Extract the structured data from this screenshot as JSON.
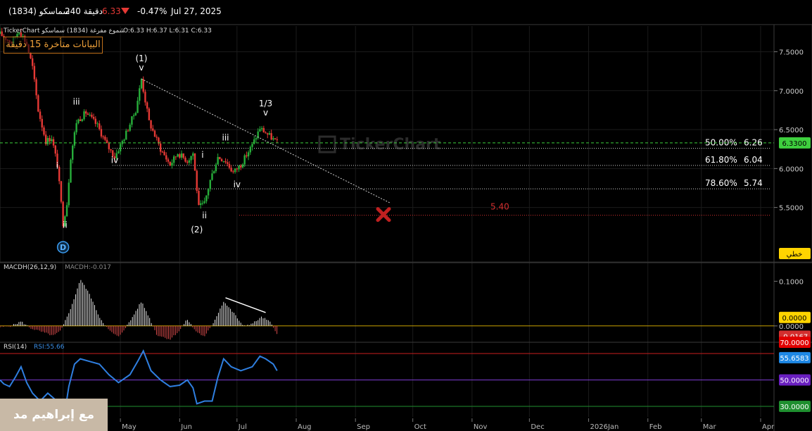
{
  "topbar": {
    "symbol": "سماسكو (1834)",
    "volume": "240 دقيقة",
    "price": "6.33",
    "change": "-0.47%",
    "date": "Jul 27, 2025"
  },
  "header": {
    "title": "TickerChart  شموع مفرغة (1834) سماسكو",
    "ohlc": "O:6.33  H:6.37  L:6.31  C:6.33"
  },
  "delay_notice": "البيانات متأخرة 15 دقيقة",
  "watermark_logo": "TickerChart",
  "watermark_author": "مع إبراهيم مد",
  "badges": {
    "last_price": "6.3300",
    "scale_mode": "خطي",
    "macd_zero": "0.0000",
    "macd_last": "-0.0167",
    "rsi_70": "70.0000",
    "rsi_last": "55.6583",
    "rsi_50": "50.0000",
    "rsi_30": "30.0000"
  },
  "fib_levels": [
    {
      "pct": "50.00%",
      "value": "6.26",
      "level": 6.26
    },
    {
      "pct": "61.80%",
      "value": "6.04",
      "level": 6.04
    },
    {
      "pct": "78.60%",
      "value": "5.74",
      "level": 5.74
    }
  ],
  "target": {
    "label": "5.40",
    "level": 5.4
  },
  "wave_labels": [
    {
      "text": "(1)",
      "x": "2025-05-12",
      "y": 7.38
    },
    {
      "text": "v",
      "x": "2025-05-12",
      "y": 7.26
    },
    {
      "text": "iii",
      "x": "2025-04-08",
      "y": 6.82
    },
    {
      "text": "iv",
      "x": "2025-04-28",
      "y": 6.07
    },
    {
      "text": "i",
      "x": "2025-03-29",
      "y": 6.0
    },
    {
      "text": "ii",
      "x": "2025-04-02",
      "y": 5.24
    },
    {
      "text": "(2)",
      "x": "2025-06-10",
      "y": 5.18
    },
    {
      "text": "ii",
      "x": "2025-06-14",
      "y": 5.36
    },
    {
      "text": "i",
      "x": "2025-06-13",
      "y": 6.14
    },
    {
      "text": "iii",
      "x": "2025-06-25",
      "y": 6.36
    },
    {
      "text": "iv",
      "x": "2025-07-01",
      "y": 5.76
    },
    {
      "text": "1/3",
      "x": "2025-07-16",
      "y": 6.8
    },
    {
      "text": "v",
      "x": "2025-07-16",
      "y": 6.68
    },
    {
      "text": "D",
      "x": "2025-04-01",
      "y": 4.99
    }
  ],
  "chart_data": [
    {
      "type": "candlestick",
      "name": "price",
      "x_ticks": [
        "Apr",
        "May",
        "Jun",
        "Jul",
        "Aug",
        "Sep",
        "Oct",
        "Nov",
        "Dec",
        "2026Jan",
        "Feb",
        "Mar",
        "Apr"
      ],
      "x_tick_dates": [
        "2025-04-01",
        "2025-05-01",
        "2025-06-01",
        "2025-07-01",
        "2025-08-01",
        "2025-09-01",
        "2025-10-01",
        "2025-11-01",
        "2025-12-01",
        "2026-01-01",
        "2026-02-01",
        "2026-03-01",
        "2026-04-01"
      ],
      "x_range": [
        "2025-02-27",
        "2026-04-08"
      ],
      "y_ticks": [
        "7.5000",
        "7.0000",
        "6.5000",
        "6.0000",
        "5.5000"
      ],
      "y_range": [
        4.8,
        7.83
      ],
      "last_price": 6.33,
      "ohlc_last": {
        "open": 6.33,
        "high": 6.37,
        "low": 6.31,
        "close": 6.33
      },
      "path": [
        [
          "2025-02-27",
          7.73
        ],
        [
          "2025-03-05",
          7.62
        ],
        [
          "2025-03-09",
          7.78
        ],
        [
          "2025-03-13",
          7.6
        ],
        [
          "2025-03-16",
          7.3
        ],
        [
          "2025-03-19",
          6.75
        ],
        [
          "2025-03-23",
          6.35
        ],
        [
          "2025-03-26",
          6.4
        ],
        [
          "2025-03-29",
          6.05
        ],
        [
          "2025-04-01",
          5.3
        ],
        [
          "2025-04-03",
          5.55
        ],
        [
          "2025-04-05",
          6.15
        ],
        [
          "2025-04-08",
          6.6
        ],
        [
          "2025-04-13",
          6.72
        ],
        [
          "2025-04-19",
          6.55
        ],
        [
          "2025-04-24",
          6.3
        ],
        [
          "2025-04-28",
          6.15
        ],
        [
          "2025-05-03",
          6.4
        ],
        [
          "2025-05-09",
          6.75
        ],
        [
          "2025-05-12",
          7.15
        ],
        [
          "2025-05-16",
          6.6
        ],
        [
          "2025-05-22",
          6.25
        ],
        [
          "2025-05-27",
          6.05
        ],
        [
          "2025-05-31",
          6.2
        ],
        [
          "2025-06-05",
          6.1
        ],
        [
          "2025-06-08",
          6.2
        ],
        [
          "2025-06-11",
          5.5
        ],
        [
          "2025-06-14",
          5.55
        ],
        [
          "2025-06-17",
          5.85
        ],
        [
          "2025-06-21",
          6.15
        ],
        [
          "2025-06-25",
          6.1
        ],
        [
          "2025-06-29",
          5.95
        ],
        [
          "2025-07-03",
          6.05
        ],
        [
          "2025-07-09",
          6.3
        ],
        [
          "2025-07-13",
          6.52
        ],
        [
          "2025-07-18",
          6.42
        ],
        [
          "2025-07-22",
          6.33
        ]
      ],
      "trendline": [
        [
          "2025-05-12",
          7.15
        ],
        [
          "2025-09-19",
          5.56
        ]
      ]
    },
    {
      "type": "bar",
      "name": "MACDH(26,12,9)",
      "legend": "MACDH(26,12,9)",
      "value_label": "MACDH:-0.017",
      "y_ticks": [
        "0.1000",
        "0.0000"
      ],
      "y_range": [
        -0.035,
        0.14
      ],
      "last_value": -0.0167,
      "path": [
        [
          "2025-02-27",
          -0.003
        ],
        [
          "2025-03-05",
          0.0
        ],
        [
          "2025-03-10",
          0.01
        ],
        [
          "2025-03-15",
          -0.005
        ],
        [
          "2025-03-22",
          -0.015
        ],
        [
          "2025-03-27",
          -0.022
        ],
        [
          "2025-03-31",
          -0.01
        ],
        [
          "2025-04-03",
          0.02
        ],
        [
          "2025-04-06",
          0.05
        ],
        [
          "2025-04-10",
          0.105
        ],
        [
          "2025-04-15",
          0.07
        ],
        [
          "2025-04-20",
          0.02
        ],
        [
          "2025-04-25",
          -0.01
        ],
        [
          "2025-04-30",
          -0.025
        ],
        [
          "2025-05-06",
          0.01
        ],
        [
          "2025-05-12",
          0.055
        ],
        [
          "2025-05-16",
          0.02
        ],
        [
          "2025-05-20",
          -0.02
        ],
        [
          "2025-05-27",
          -0.03
        ],
        [
          "2025-06-01",
          -0.01
        ],
        [
          "2025-06-05",
          0.015
        ],
        [
          "2025-06-09",
          -0.01
        ],
        [
          "2025-06-14",
          -0.025
        ],
        [
          "2025-06-19",
          0.01
        ],
        [
          "2025-06-24",
          0.055
        ],
        [
          "2025-06-30",
          0.025
        ],
        [
          "2025-07-04",
          0.0
        ],
        [
          "2025-07-09",
          0.005
        ],
        [
          "2025-07-14",
          0.02
        ],
        [
          "2025-07-18",
          0.01
        ],
        [
          "2025-07-22",
          -0.0167
        ]
      ],
      "divergence_line": [
        [
          "2025-06-25",
          0.063
        ],
        [
          "2025-07-16",
          0.03
        ]
      ]
    },
    {
      "type": "line",
      "name": "RSI(14)",
      "legend": "RSI(14)",
      "value_label": "RSI:55.66",
      "y_range": [
        22,
        78
      ],
      "levels": [
        70,
        50,
        30
      ],
      "last_value": 55.6583,
      "values": [
        [
          "2025-02-27",
          50
        ],
        [
          "2025-03-01",
          47
        ],
        [
          "2025-03-04",
          45
        ],
        [
          "2025-03-07",
          52
        ],
        [
          "2025-03-10",
          60
        ],
        [
          "2025-03-13",
          48
        ],
        [
          "2025-03-16",
          40
        ],
        [
          "2025-03-20",
          34
        ],
        [
          "2025-03-24",
          40
        ],
        [
          "2025-03-28",
          35
        ],
        [
          "2025-03-31",
          28
        ],
        [
          "2025-04-02",
          26
        ],
        [
          "2025-04-04",
          45
        ],
        [
          "2025-04-07",
          62
        ],
        [
          "2025-04-10",
          66
        ],
        [
          "2025-04-15",
          64
        ],
        [
          "2025-04-20",
          62
        ],
        [
          "2025-04-25",
          54
        ],
        [
          "2025-04-30",
          48
        ],
        [
          "2025-05-06",
          54
        ],
        [
          "2025-05-10",
          64
        ],
        [
          "2025-05-13",
          72
        ],
        [
          "2025-05-17",
          57
        ],
        [
          "2025-05-22",
          50
        ],
        [
          "2025-05-27",
          45
        ],
        [
          "2025-06-01",
          46
        ],
        [
          "2025-06-05",
          50
        ],
        [
          "2025-06-08",
          44
        ],
        [
          "2025-06-10",
          32
        ],
        [
          "2025-06-14",
          34
        ],
        [
          "2025-06-18",
          34
        ],
        [
          "2025-06-21",
          52
        ],
        [
          "2025-06-24",
          66
        ],
        [
          "2025-06-28",
          60
        ],
        [
          "2025-07-03",
          57
        ],
        [
          "2025-07-09",
          60
        ],
        [
          "2025-07-13",
          68
        ],
        [
          "2025-07-16",
          66
        ],
        [
          "2025-07-20",
          62
        ],
        [
          "2025-07-22",
          57
        ]
      ]
    }
  ],
  "colors": {
    "up": "#27ae3a",
    "down": "#e53935",
    "grid": "#1b1b1b",
    "macd_pos": "#e6e6e6",
    "macd_neg": "#d94b4b",
    "rsi_line": "#2f7fe0",
    "rsi_70": "#c81e1e",
    "rsi_50": "#7b3bd0",
    "rsi_30": "#1f8f2f",
    "accent_green": "#3ecf3e",
    "fib_line": "#cfcfcf",
    "target_red": "#d32f2f"
  }
}
